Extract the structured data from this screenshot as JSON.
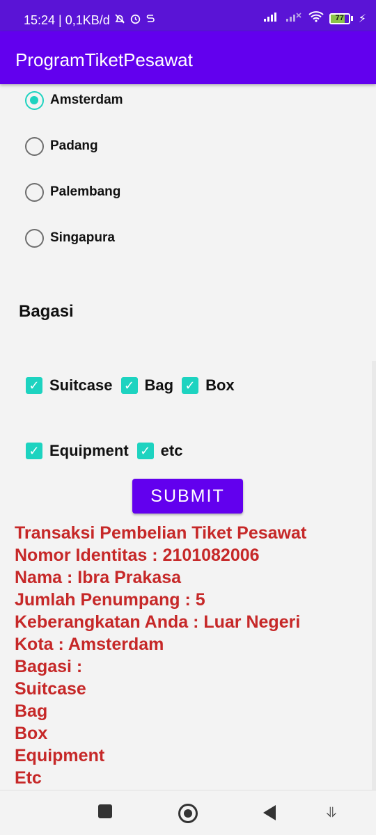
{
  "status_bar": {
    "time_net": "15:24 | 0,1KB/d",
    "icons_left": [
      "bell-off-icon",
      "alarm-icon",
      "s-icon"
    ],
    "icons_right": [
      "signal-icon",
      "signal-x-icon",
      "wifi-icon"
    ],
    "battery_text": "77",
    "battery_level": 0.77,
    "charging_icon": "⚡"
  },
  "app_bar": {
    "title": "ProgramTiketPesawat"
  },
  "cities": [
    {
      "label": "Amsterdam",
      "checked": true
    },
    {
      "label": "Padang",
      "checked": false
    },
    {
      "label": "Palembang",
      "checked": false
    },
    {
      "label": "Singapura",
      "checked": false
    }
  ],
  "baggage": {
    "title": "Bagasi",
    "row1": [
      "Suitcase",
      "Bag",
      "Box"
    ],
    "row2": [
      "Equipment",
      "etc"
    ],
    "check_glyph": "✓"
  },
  "submit_label": "SUBMIT",
  "result": {
    "line1": "Transaksi Pembelian Tiket Pesawat",
    "line2": "Nomor Identitas : 2101082006",
    "line3": "Nama : Ibra Prakasa",
    "line4": "Jumlah Penumpang : 5",
    "line5": "Keberangkatan Anda : Luar Negeri",
    "line6": "Kota : Amsterdam",
    "line7": "Bagasi :",
    "line8": "Suitcase",
    "line9": "Bag",
    "line10": "Box",
    "line11": "Equipment",
    "line12": "Etc"
  },
  "nav": {
    "assist_glyph": "⥥"
  }
}
